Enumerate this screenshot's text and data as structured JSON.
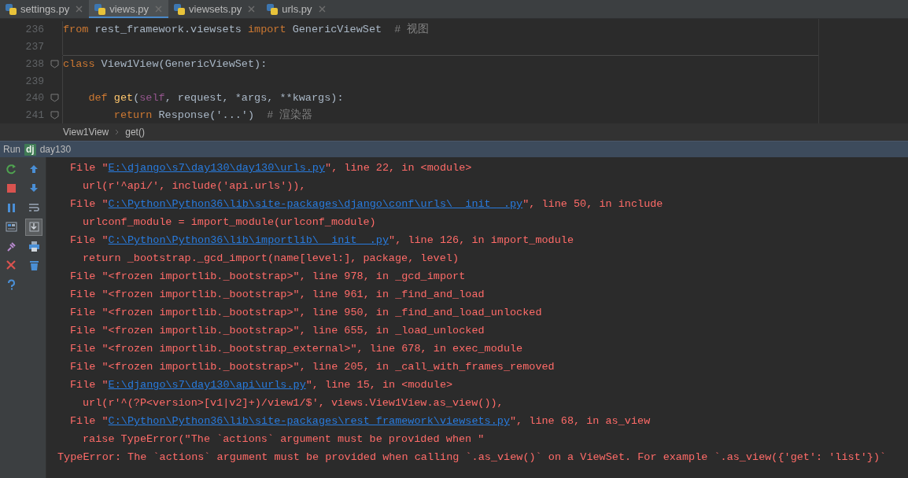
{
  "tabs": [
    {
      "label": "settings.py",
      "selected": false
    },
    {
      "label": "views.py",
      "selected": true
    },
    {
      "label": "viewsets.py",
      "selected": false
    },
    {
      "label": "urls.py",
      "selected": false
    }
  ],
  "editor": {
    "lines": [
      {
        "number": "236",
        "fold": false,
        "tokens": [
          {
            "t": "from",
            "color": "#cc7832"
          },
          {
            "t": " rest_framework.viewsets ",
            "color": "#a9b7c6"
          },
          {
            "t": "import",
            "color": "#cc7832"
          },
          {
            "t": " GenericViewSet  ",
            "color": "#a9b7c6"
          },
          {
            "t": "# 视图",
            "color": "#808080"
          }
        ]
      },
      {
        "number": "237",
        "fold": false
      },
      {
        "number": "238",
        "fold": true,
        "tokens": [
          {
            "t": "class",
            "color": "#cc7832"
          },
          {
            "t": " View1View(GenericViewSet):",
            "color": "#a9b7c6"
          }
        ]
      },
      {
        "number": "239",
        "fold": false
      },
      {
        "number": "240",
        "fold": true,
        "tokens": [
          {
            "t": "    def",
            "color": "#cc7832"
          },
          {
            "t": " get",
            "color": "#ffc66d"
          },
          {
            "t": "(",
            "color": "#a9b7c6"
          },
          {
            "t": "self",
            "color": "#94558d"
          },
          {
            "t": ", request, *args, **kwargs):",
            "color": "#a9b7c6"
          }
        ]
      },
      {
        "number": "241",
        "fold": true,
        "tokens": [
          {
            "t": "        return",
            "color": "#cc7832"
          },
          {
            "t": " Response('...')  ",
            "color": "#a9b7c6"
          },
          {
            "t": "# 渲染器",
            "color": "#808080"
          }
        ]
      }
    ]
  },
  "breadcrumbs": [
    "View1View",
    "get()"
  ],
  "run": {
    "label": "Run",
    "config_icon": "dj",
    "config": "day130"
  },
  "toolbar": [
    {
      "kind": "rerun",
      "on": false
    },
    {
      "kind": "up",
      "on": false
    },
    {
      "kind": "stop",
      "on": false
    },
    {
      "kind": "down",
      "on": false
    },
    {
      "kind": "pause",
      "on": false
    },
    {
      "kind": "wrap",
      "on": false
    },
    {
      "kind": "layout",
      "on": false
    },
    {
      "kind": "scroll-end",
      "on": true
    },
    {
      "kind": "pin",
      "on": false
    },
    {
      "kind": "print",
      "on": false
    },
    {
      "kind": "close",
      "on": false
    },
    {
      "kind": "trash",
      "on": false
    },
    {
      "kind": "help",
      "on": false
    }
  ],
  "console": [
    {
      "kind": "file",
      "pre": "File \"",
      "link": "E:\\django\\s7\\day130\\day130\\urls.py",
      "post": "\", line 22, in <module>"
    },
    {
      "kind": "code",
      "text": "url(r'^api/', include('api.urls')),"
    },
    {
      "kind": "file",
      "pre": "File \"",
      "link": "C:\\Python\\Python36\\lib\\site-packages\\django\\conf\\urls\\__init__.py",
      "post": "\", line 50, in include"
    },
    {
      "kind": "code",
      "text": "urlconf_module = import_module(urlconf_module)"
    },
    {
      "kind": "file",
      "pre": "File \"",
      "link": "C:\\Python\\Python36\\lib\\importlib\\__init__.py",
      "post": "\", line 126, in import_module"
    },
    {
      "kind": "code",
      "text": "return _bootstrap._gcd_import(name[level:], package, level)"
    },
    {
      "kind": "file",
      "pre": "File \"<frozen importlib._bootstrap>\", line 978, in _gcd_import"
    },
    {
      "kind": "file",
      "pre": "File \"<frozen importlib._bootstrap>\", line 961, in _find_and_load"
    },
    {
      "kind": "file",
      "pre": "File \"<frozen importlib._bootstrap>\", line 950, in _find_and_load_unlocked"
    },
    {
      "kind": "file",
      "pre": "File \"<frozen importlib._bootstrap>\", line 655, in _load_unlocked"
    },
    {
      "kind": "file",
      "pre": "File \"<frozen importlib._bootstrap_external>\", line 678, in exec_module"
    },
    {
      "kind": "file",
      "pre": "File \"<frozen importlib._bootstrap>\", line 205, in _call_with_frames_removed"
    },
    {
      "kind": "file",
      "pre": "File \"",
      "link": "E:\\django\\s7\\day130\\api\\urls.py",
      "post": "\", line 15, in <module>"
    },
    {
      "kind": "code",
      "text": "url(r'^(?P<version>[v1|v2]+)/view1/$', views.View1View.as_view()),"
    },
    {
      "kind": "file",
      "pre": "File \"",
      "link": "C:\\Python\\Python36\\lib\\site-packages\\rest_framework\\viewsets.py",
      "post": "\", line 68, in as_view"
    },
    {
      "kind": "code",
      "text": "raise TypeError(\"The `actions` argument must be provided when \""
    },
    {
      "kind": "error",
      "text": "TypeError: The `actions` argument must be provided when calling `.as_view()` on a ViewSet. For example `.as_view({'get': 'list'})`"
    }
  ]
}
